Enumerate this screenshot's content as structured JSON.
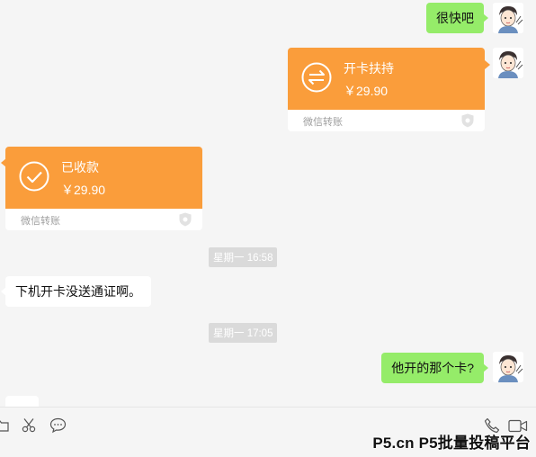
{
  "messages": {
    "m1": {
      "text": "很快吧"
    },
    "m2": {
      "title": "开卡扶持",
      "amount": "￥29.90",
      "footer": "微信转账"
    },
    "m3": {
      "title": "已收款",
      "amount": "￥29.90",
      "footer": "微信转账"
    },
    "time1": "星期一 16:58",
    "m4": {
      "text": "下机开卡没送通证啊。"
    },
    "time2": "星期一 17:05",
    "m5": {
      "text": "他开的那个卡?"
    }
  },
  "colors": {
    "chat_bg": "#f5f5f5",
    "sent_bubble": "#95ec69",
    "received_bubble": "#ffffff",
    "transfer_orange": "#fa9d3b",
    "timestamp_bg": "#dadada"
  },
  "toolbar": {
    "icons": [
      "folder-icon",
      "scissors-icon",
      "chat-bubble-icon",
      "phone-icon",
      "video-call-icon"
    ]
  },
  "watermark": "P5.cn P5批量投稿平台"
}
